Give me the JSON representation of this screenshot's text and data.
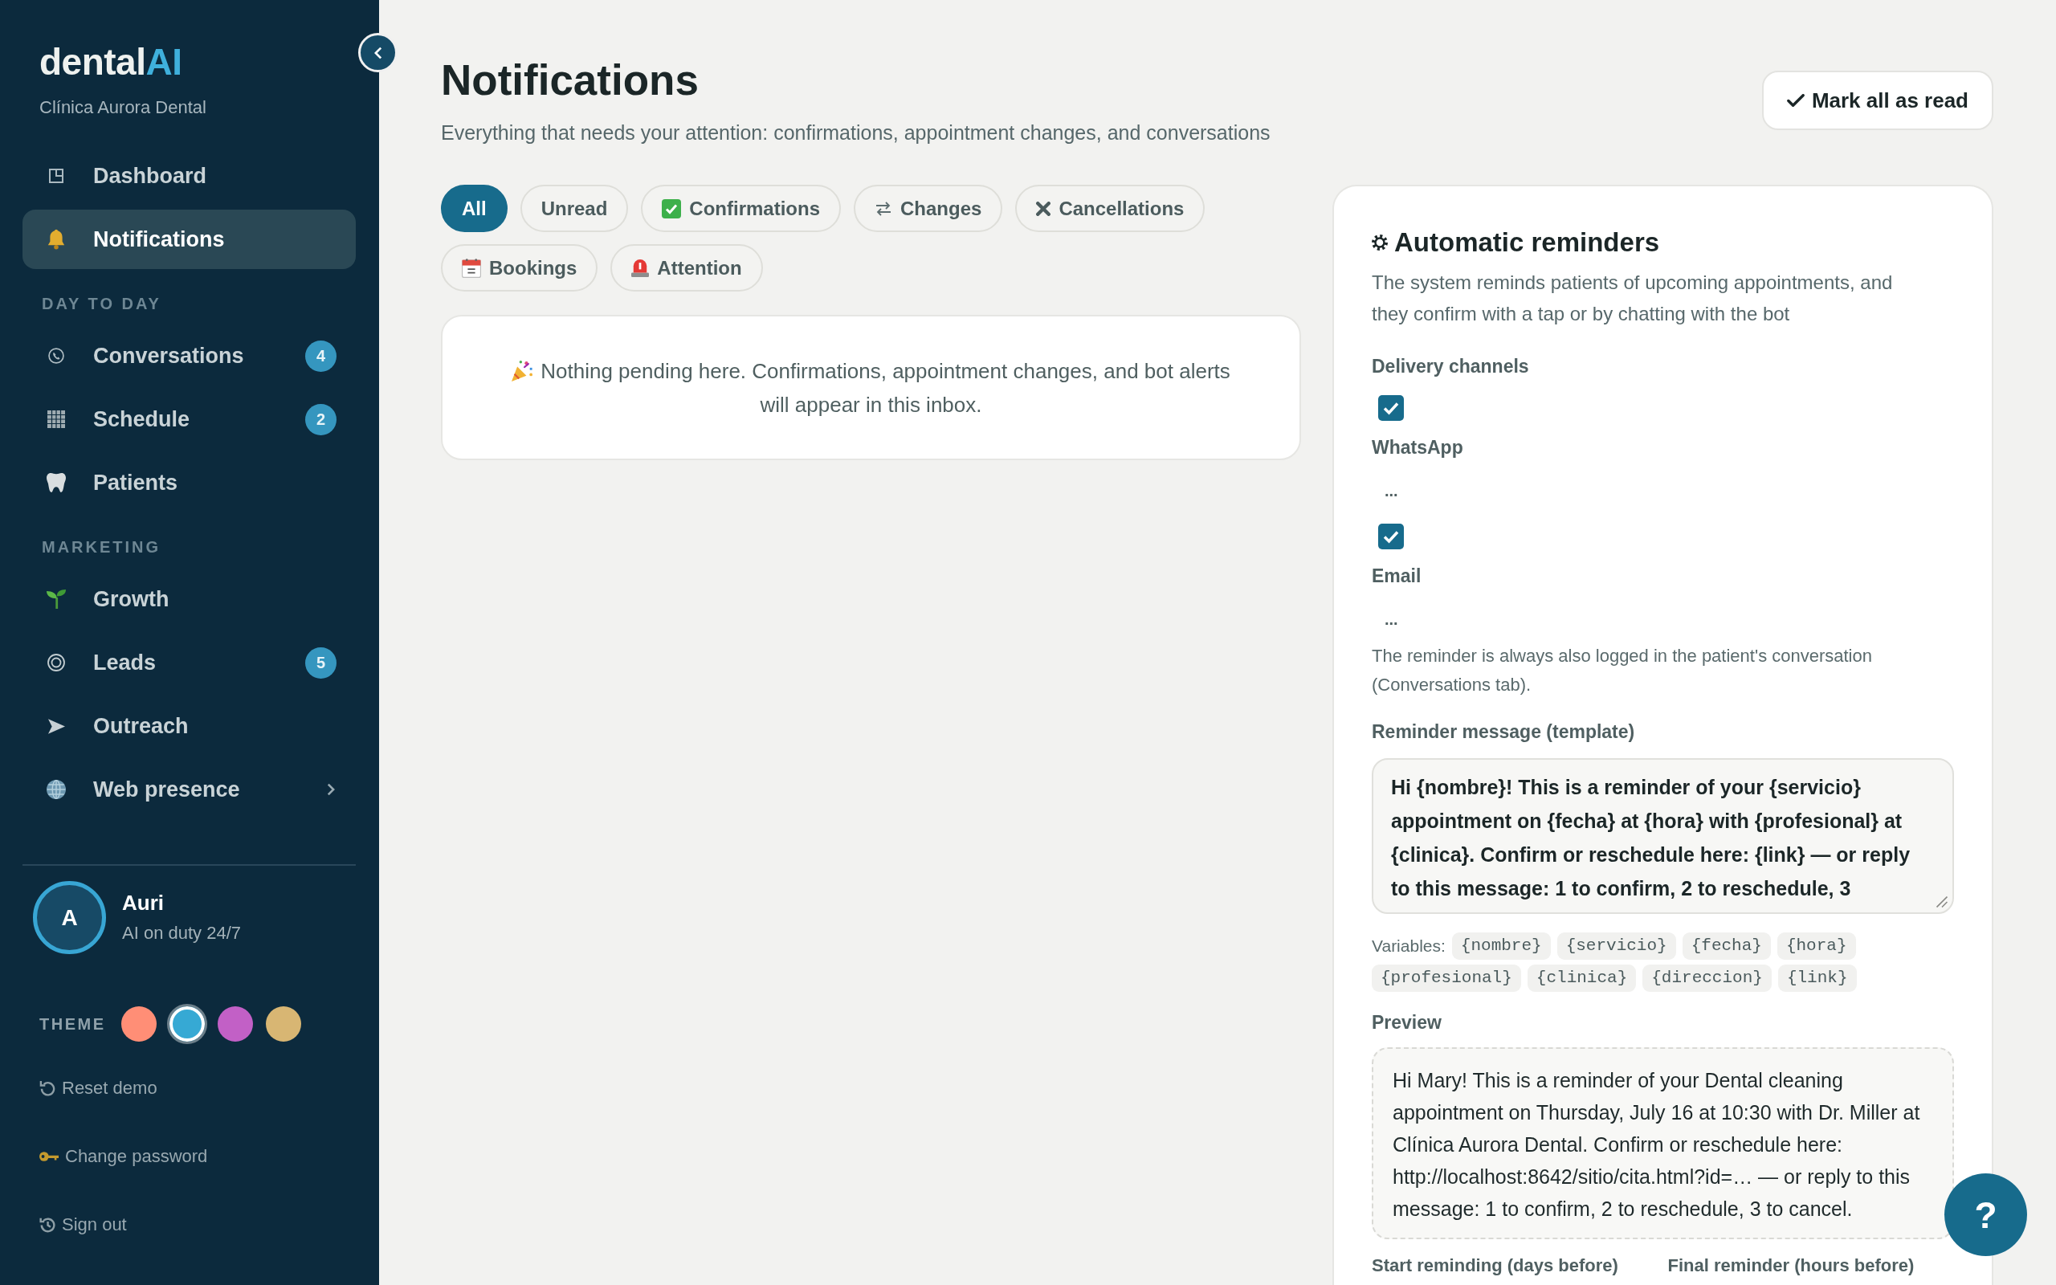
{
  "sidebar": {
    "logo": {
      "text": "dental",
      "accent": "AI"
    },
    "clinic": "Clínica Aurora Dental",
    "nav_groups": [
      {
        "items": [
          {
            "label": "Dashboard",
            "selected": false
          },
          {
            "label": "Notifications",
            "selected": true
          }
        ]
      },
      {
        "title": "DAY TO DAY",
        "items": [
          {
            "label": "Conversations",
            "badge": "4",
            "selected": false
          },
          {
            "label": "Schedule",
            "badge": "2",
            "selected": false
          },
          {
            "label": "Patients",
            "selected": false
          }
        ]
      },
      {
        "title": "MARKETING",
        "items": [
          {
            "label": "Growth",
            "selected": false
          },
          {
            "label": "Leads",
            "badge": "5",
            "selected": false
          },
          {
            "label": "Outreach",
            "selected": false
          },
          {
            "label": "Web presence",
            "selected": false,
            "submenu": true
          }
        ]
      }
    ],
    "profile": {
      "initial": "A",
      "name": "Auri",
      "status": "AI on duty 24/7"
    },
    "theme": {
      "label": "THEME",
      "swatches": [
        {
          "color": "#ff8e76",
          "selected": false
        },
        {
          "color": "#36a9d4",
          "selected": true
        },
        {
          "color": "#c260c6",
          "selected": false
        },
        {
          "color": "#d8b673",
          "selected": false
        }
      ]
    },
    "links": [
      "Reset demo",
      "Change password",
      "Sign out"
    ]
  },
  "header": {
    "title": "Notifications",
    "subtitle": "Everything that needs your attention: confirmations, appointment changes, and conversations",
    "action": "Mark all as read"
  },
  "filters": [
    {
      "label": "All",
      "selected": true
    },
    {
      "label": "Unread",
      "selected": false
    },
    {
      "label": "Confirmations",
      "selected": false
    },
    {
      "label": "Changes",
      "selected": false
    },
    {
      "label": "Cancellations",
      "selected": false
    },
    {
      "label": "Bookings",
      "selected": false
    },
    {
      "label": "Attention",
      "selected": false
    }
  ],
  "empty_state": {
    "message": "Nothing pending here. Confirmations, appointment changes, and bot alerts will appear in this inbox."
  },
  "reminders": {
    "title": "Automatic reminders",
    "description": "The system reminds patients of upcoming appointments, and they confirm with a tap or by chatting with the bot",
    "channels_label": "Delivery channels",
    "channels": [
      {
        "label": "WhatsApp",
        "checked": true,
        "detail": "..."
      },
      {
        "label": "Email",
        "checked": true,
        "detail": "..."
      }
    ],
    "note": "The reminder is always also logged in the patient's conversation (Conversations tab).",
    "template_label": "Reminder message (template)",
    "template": "Hi {nombre}! This is a reminder of your {servicio} appointment on {fecha} at {hora} with {profesional} at {clinica}. Confirm or reschedule here: {link} — or reply to this message: 1 to confirm, 2 to reschedule, 3",
    "variables_label": "Variables:",
    "variables": [
      "{nombre}",
      "{servicio}",
      "{fecha}",
      "{hora}",
      "{profesional}",
      "{clinica}",
      "{direccion}",
      "{link}"
    ],
    "preview_label": "Preview",
    "preview": "Hi Mary! This is a reminder of your Dental cleaning appointment on Thursday, July 16 at 10:30 with Dr. Miller at Clínica Aurora Dental. Confirm or reschedule here: http://localhost:8642/sitio/cita.html?id=… — or reply to this message: 1 to confirm, 2 to reschedule, 3 to cancel.",
    "timing_labels": [
      "Start reminding (days before)",
      "Final reminder (hours before)"
    ]
  },
  "help_button": "?"
}
